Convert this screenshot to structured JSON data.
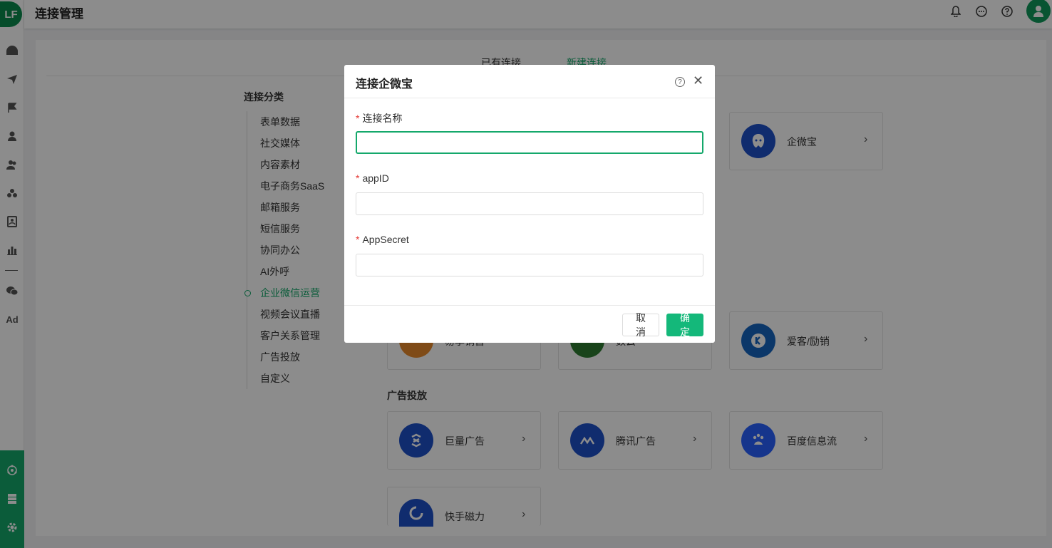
{
  "app": {
    "logo_text": "LF"
  },
  "header": {
    "title": "连接管理"
  },
  "rail": {
    "ad_label": "Ad"
  },
  "tabs": [
    {
      "label": "已有连接"
    },
    {
      "label": "新建连接"
    }
  ],
  "sidebar": {
    "title": "连接分类",
    "items": [
      {
        "label": "表单数据"
      },
      {
        "label": "社交媒体"
      },
      {
        "label": "内容素材"
      },
      {
        "label": "电子商务SaaS"
      },
      {
        "label": "邮箱服务"
      },
      {
        "label": "短信服务"
      },
      {
        "label": "协同办公"
      },
      {
        "label": "AI外呼"
      },
      {
        "label": "企业微信运营"
      },
      {
        "label": "视频会议直播"
      },
      {
        "label": "客户关系管理"
      },
      {
        "label": "广告投放"
      },
      {
        "label": "自定义"
      }
    ]
  },
  "cards": {
    "qiweibao": {
      "label": "企微宝",
      "color": "#1e50c8"
    },
    "row2a": {
      "label": "易享销售",
      "color": "#e8892a"
    },
    "row2b": {
      "label": "数云",
      "color": "#2e7d32"
    },
    "row2c": {
      "label": "爱客/励销",
      "color": "#1565c0"
    },
    "ads_section_title": "广告投放",
    "juliang": {
      "label": "巨量广告",
      "color": "#1e50c8"
    },
    "tengxun": {
      "label": "腾讯广告",
      "color": "#1e50c8"
    },
    "baidu": {
      "label": "百度信息流",
      "color": "#2962ff"
    },
    "kuaishou": {
      "label": "快手磁力",
      "color": "#1e50c8"
    }
  },
  "modal": {
    "title": "连接企微宝",
    "fields": [
      {
        "label": "连接名称",
        "required": "*",
        "value": ""
      },
      {
        "label": "appID",
        "required": "*",
        "value": ""
      },
      {
        "label": "AppSecret",
        "required": "*",
        "value": ""
      }
    ],
    "cancel": "取消",
    "ok": "确定"
  },
  "colors": {
    "accent": "#14a86b",
    "primary_button": "#14b87a",
    "required": "#e53935"
  }
}
